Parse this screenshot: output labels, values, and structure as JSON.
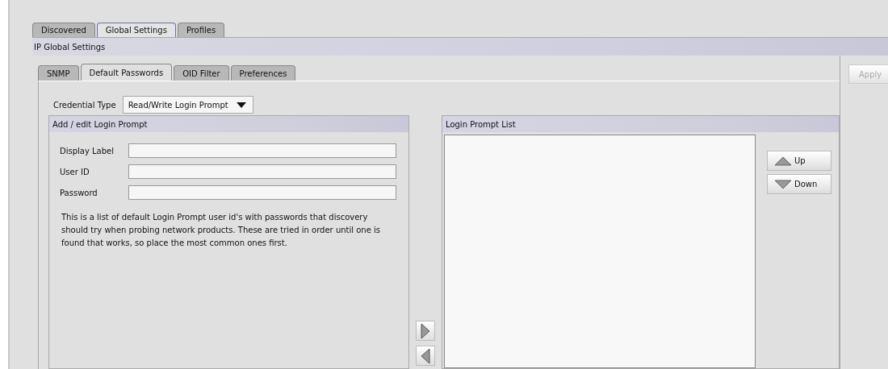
{
  "outer_tabs": [
    {
      "label": "Discovered",
      "selected": false
    },
    {
      "label": "Global Settings",
      "selected": true
    },
    {
      "label": "Profiles",
      "selected": false
    }
  ],
  "section_title": "IP Global Settings",
  "inner_tabs": [
    {
      "label": "SNMP",
      "selected": false
    },
    {
      "label": "Default Passwords",
      "selected": true
    },
    {
      "label": "OID Filter",
      "selected": false
    },
    {
      "label": "Preferences",
      "selected": false
    }
  ],
  "apply_button": {
    "label": "Apply",
    "disabled": true
  },
  "credential_type": {
    "label": "Credential Type",
    "value": "Read/Write Login Prompt"
  },
  "edit_panel": {
    "title": "Add / edit Login Prompt",
    "fields": [
      {
        "label": "Display Label"
      },
      {
        "label": "User ID"
      },
      {
        "label": "Password"
      }
    ],
    "description": "This is a list of default Login Prompt user id's with passwords that discovery should try when probing network products. These are tried in order until one is found that works, so place the most common ones first."
  },
  "list_panel": {
    "title": "Login Prompt List",
    "buttons": [
      {
        "label": "Up",
        "kind": "up"
      },
      {
        "label": "Down",
        "kind": "down"
      }
    ]
  }
}
